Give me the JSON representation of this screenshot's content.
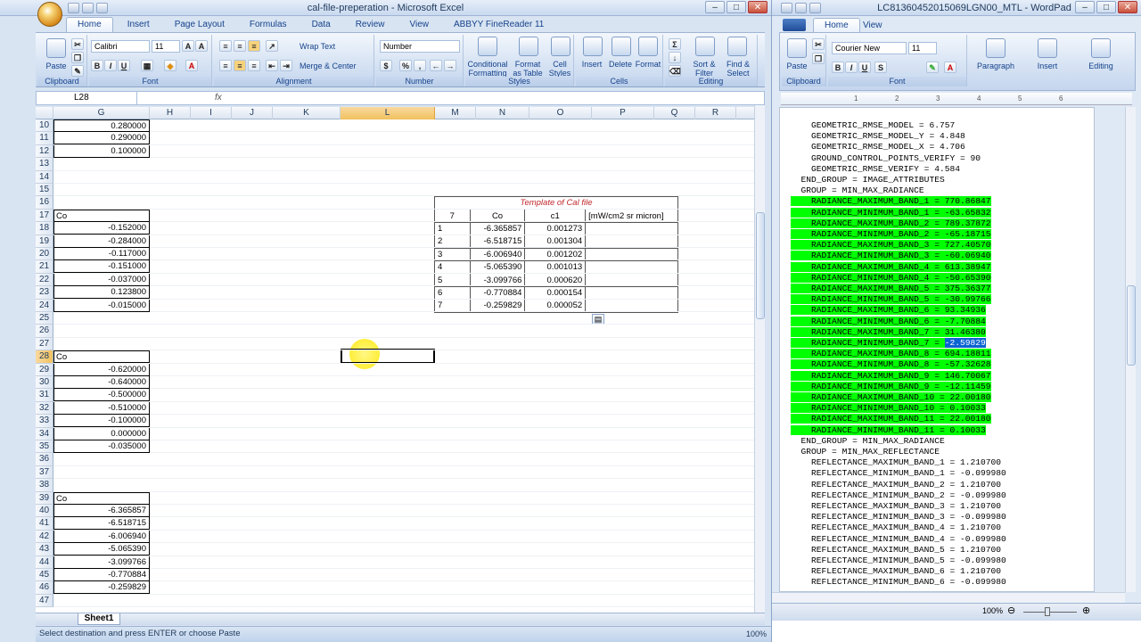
{
  "excel": {
    "title": "cal-file-preperation - Microsoft Excel",
    "tabs": [
      "Home",
      "Insert",
      "Page Layout",
      "Formulas",
      "Data",
      "Review",
      "View",
      "ABBYY FineReader 11"
    ],
    "ribbon": {
      "paste": "Paste",
      "font_name": "Calibri",
      "font_size": "11",
      "wrap_text": "Wrap Text",
      "merge_center": "Merge & Center",
      "number_format": "Number",
      "conditional_formatting": "Conditional Formatting",
      "format_as_table": "Format as Table",
      "cell_styles": "Cell Styles",
      "insert": "Insert",
      "delete": "Delete",
      "format": "Format",
      "sort_filter": "Sort & Filter",
      "find_select": "Find & Select",
      "groups": [
        "Clipboard",
        "Font",
        "Alignment",
        "Number",
        "Styles",
        "Cells",
        "Editing"
      ]
    },
    "name_box": "L28",
    "fx": "fx",
    "columns": [
      "G",
      "H",
      "I",
      "J",
      "K",
      "L",
      "M",
      "N",
      "O",
      "P",
      "Q",
      "R"
    ],
    "row_numbers": [
      "10",
      "11",
      "12",
      "13",
      "14",
      "15",
      "16",
      "17",
      "18",
      "19",
      "20",
      "21",
      "22",
      "23",
      "24",
      "25",
      "26",
      "27",
      "28",
      "29",
      "30",
      "31",
      "32",
      "33",
      "34",
      "35",
      "36",
      "37",
      "38",
      "39",
      "40",
      "41",
      "42",
      "43",
      "44",
      "45",
      "46",
      "47"
    ],
    "g_column": {
      "10": "0.280000",
      "11": "0.290000",
      "12": "0.100000",
      "17": "Co",
      "18": "-0.152000",
      "19": "-0.284000",
      "20": "-0.117000",
      "21": "-0.151000",
      "22": "-0.037000",
      "23": "0.123800",
      "24": "-0.015000",
      "28": "Co",
      "29": "-0.620000",
      "30": "-0.640000",
      "31": "-0.500000",
      "32": "-0.510000",
      "33": "-0.100000",
      "34": "0.000000",
      "35": "-0.035000",
      "39": "Co",
      "40": "-6.365857",
      "41": "-6.518715",
      "42": "-6.006940",
      "43": "-5.065390",
      "44": "-3.099766",
      "45": "-0.770884",
      "46": "-0.259829"
    },
    "template": {
      "title": "Template of Cal file",
      "header": [
        "7",
        "Co",
        "c1",
        "[mW/cm2 sr micron]"
      ],
      "rows": [
        [
          "1",
          "-6.365857",
          "0.001273",
          ""
        ],
        [
          "2",
          "-6.518715",
          "0.001304",
          ""
        ],
        [
          "3",
          "-6.006940",
          "0.001202",
          ""
        ],
        [
          "4",
          "-5.065390",
          "0.001013",
          ""
        ],
        [
          "5",
          "-3.099766",
          "0.000620",
          ""
        ],
        [
          "6",
          "-0.770884",
          "0.000154",
          ""
        ],
        [
          "7",
          "-0.259829",
          "0.000052",
          ""
        ]
      ]
    },
    "sheet_tab": "Sheet1",
    "status": "Select destination and press ENTER or choose Paste",
    "zoom": "100%"
  },
  "wordpad": {
    "title": "LC81360452015069LGN00_MTL - WordPad",
    "tabs": [
      "Home",
      "View"
    ],
    "ribbon": {
      "paste": "Paste",
      "font_name": "Courier New",
      "font_size": "11",
      "paragraph": "Paragraph",
      "insert": "Insert",
      "editing": "Editing",
      "groups": [
        "Clipboard",
        "Font"
      ]
    },
    "ruler": [
      "1",
      "2",
      "3",
      "4",
      "5",
      "6"
    ],
    "lines_plain_top": [
      "    GEOMETRIC_RMSE_MODEL = 6.757",
      "    GEOMETRIC_RMSE_MODEL_Y = 4.848",
      "    GEOMETRIC_RMSE_MODEL_X = 4.706",
      "    GROUND_CONTROL_POINTS_VERIFY = 90",
      "    GEOMETRIC_RMSE_VERIFY = 4.584",
      "  END_GROUP = IMAGE_ATTRIBUTES",
      "  GROUP = MIN_MAX_RADIANCE"
    ],
    "lines_highlighted": [
      "    RADIANCE_MAXIMUM_BAND_1 = 770.86847",
      "    RADIANCE_MINIMUM_BAND_1 = -63.65832",
      "    RADIANCE_MAXIMUM_BAND_2 = 789.37872",
      "    RADIANCE_MINIMUM_BAND_2 = -65.18715",
      "    RADIANCE_MAXIMUM_BAND_3 = 727.40570",
      "    RADIANCE_MINIMUM_BAND_3 = -60.06940",
      "    RADIANCE_MAXIMUM_BAND_4 = 613.38947",
      "    RADIANCE_MINIMUM_BAND_4 = -50.65390",
      "    RADIANCE_MAXIMUM_BAND_5 = 375.36377",
      "    RADIANCE_MINIMUM_BAND_5 = -30.99766",
      "    RADIANCE_MAXIMUM_BAND_6 = 93.34936",
      "    RADIANCE_MINIMUM_BAND_6 = -7.70884",
      "    RADIANCE_MAXIMUM_BAND_7 = 31.46380",
      "    RADIANCE_MINIMUM_BAND_7 = ",
      "    RADIANCE_MAXIMUM_BAND_8 = 694.18811",
      "    RADIANCE_MINIMUM_BAND_8 = -57.32628",
      "    RADIANCE_MAXIMUM_BAND_9 = 146.70067",
      "    RADIANCE_MINIMUM_BAND_9 = -12.11459",
      "    RADIANCE_MAXIMUM_BAND_10 = 22.00180",
      "    RADIANCE_MINIMUM_BAND_10 = 0.10033",
      "    RADIANCE_MAXIMUM_BAND_11 = 22.00180",
      "    RADIANCE_MINIMUM_BAND_11 = 0.10033"
    ],
    "selected_text": "-2.59829",
    "lines_plain_bottom": [
      "  END_GROUP = MIN_MAX_RADIANCE",
      "  GROUP = MIN_MAX_REFLECTANCE",
      "    REFLECTANCE_MAXIMUM_BAND_1 = 1.210700",
      "    REFLECTANCE_MINIMUM_BAND_1 = -0.099980",
      "    REFLECTANCE_MAXIMUM_BAND_2 = 1.210700",
      "    REFLECTANCE_MINIMUM_BAND_2 = -0.099980",
      "    REFLECTANCE_MAXIMUM_BAND_3 = 1.210700",
      "    REFLECTANCE_MINIMUM_BAND_3 = -0.099980",
      "    REFLECTANCE_MAXIMUM_BAND_4 = 1.210700",
      "    REFLECTANCE_MINIMUM_BAND_4 = -0.099980",
      "    REFLECTANCE_MAXIMUM_BAND_5 = 1.210700",
      "    REFLECTANCE_MINIMUM_BAND_5 = -0.099980",
      "    REFLECTANCE_MAXIMUM_BAND_6 = 1.210700",
      "    REFLECTANCE_MINIMUM_BAND_6 = -0.099980"
    ],
    "zoom": "100%"
  }
}
